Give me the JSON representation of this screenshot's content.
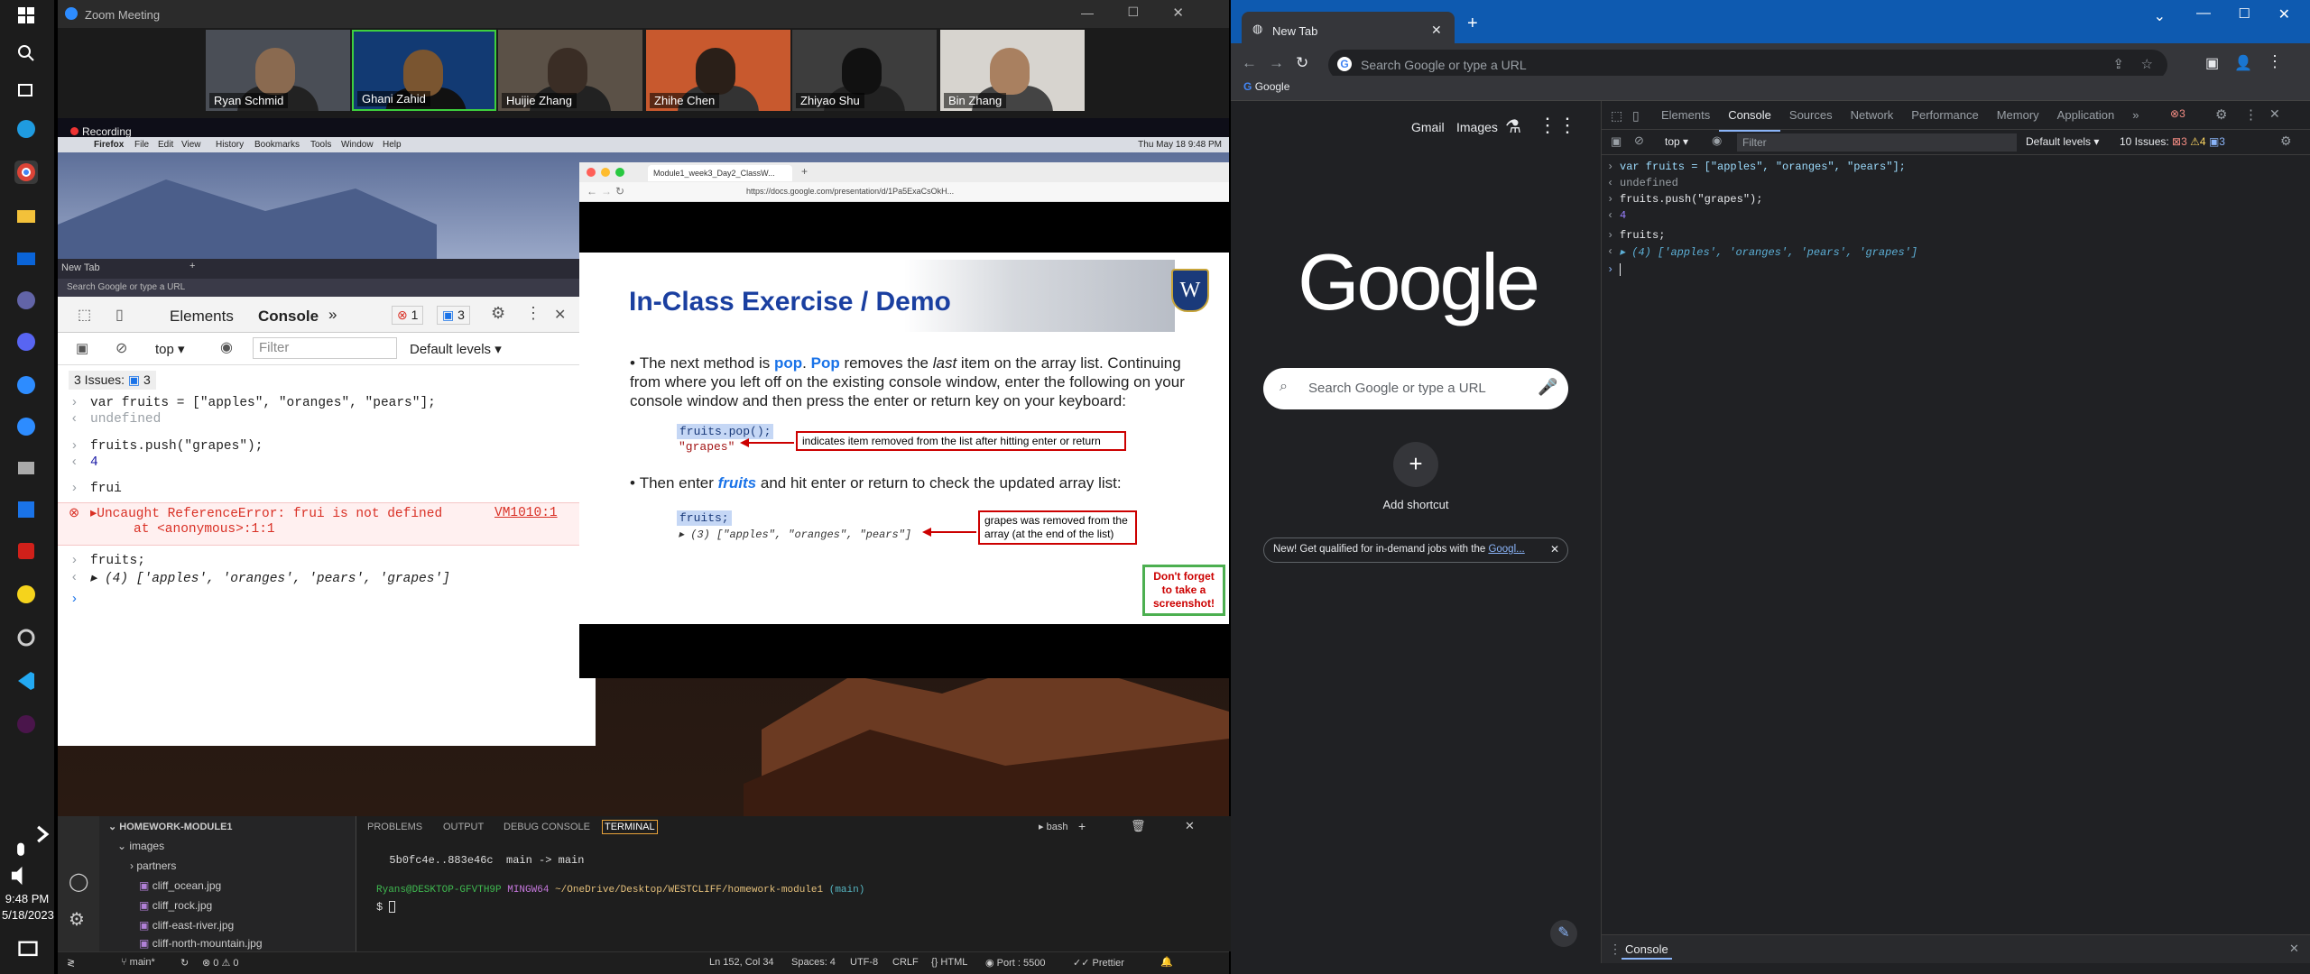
{
  "taskbar": {
    "time": "9:48 PM",
    "date": "5/18/2023",
    "icons": [
      "windows-icon",
      "search-icon",
      "task-view-icon",
      "edge-icon",
      "chrome-icon",
      "file-explorer-icon",
      "mail-icon",
      "teams-icon",
      "discord-icon",
      "zoom-icon",
      "zoom-alt-icon",
      "store-icon",
      "apps-icon",
      "acrobat-icon",
      "norton-icon",
      "settings-icon",
      "vscode-icon",
      "slack-icon"
    ]
  },
  "zoom": {
    "title": "Zoom Meeting",
    "participants": [
      "Ryan Schmid",
      "Ghani Zahid",
      "Huijie Zhang",
      "Zhihe Chen",
      "Zhiyao Shu",
      "Bin Zhang"
    ],
    "recording": "Recording",
    "mac_menu": {
      "apple": "",
      "app": "Firefox",
      "items": [
        "File",
        "Edit",
        "View",
        "History",
        "Bookmarks",
        "Tools",
        "Window",
        "Help"
      ],
      "clock": "Thu May 18  9:48 PM"
    },
    "left_browser": {
      "tab": "New Tab",
      "address": "Search Google or type a URL",
      "devtools_tabs": [
        "Elements",
        "Console"
      ],
      "errors": "1",
      "issues_count": "3",
      "context": "top",
      "filter_placeholder": "Filter",
      "levels": "Default levels",
      "issues_label": "3 Issues:",
      "issues_num": "3",
      "lines": [
        {
          "p": ">",
          "t": "var fruits = [\"apples\", \"oranges\", \"pears\"];"
        },
        {
          "p": "<",
          "t": "undefined"
        },
        {
          "p": ">",
          "t": "fruits.push(\"grapes\");"
        },
        {
          "p": "<",
          "t": "4"
        },
        {
          "p": ">",
          "t": "frui"
        },
        {
          "p": "x",
          "t": "Uncaught ReferenceError: frui is not defined"
        },
        {
          "p": "",
          "t": "at <anonymous>:1:1"
        },
        {
          "p": ">",
          "t": "fruits;"
        },
        {
          "p": "<",
          "t": "(4) ['apples', 'oranges', 'pears', 'grapes']"
        }
      ],
      "error_source": "VM1010:1"
    },
    "slides": {
      "tab": "Module1_week3_Day2_ClassW...",
      "url": "https://docs.google.com/presentation/d/1Pa5ExaCsOkH...",
      "title": "In-Class Exercise / Demo",
      "b1_a": "The next method is ",
      "b1_pop1": "pop",
      "b1_dot": ". ",
      "b1_pop2": "Pop",
      "b1_b": " removes the ",
      "b1_last": "last",
      "b1_c": " item on the array list. Continuing from where you left off on the existing console window, enter the following on your console window and then press the enter or return key on your keyboard:",
      "code1": "fruits.pop();",
      "code1_out": "\"grapes\"",
      "note1": "indicates item removed from the list after hitting enter or return",
      "b2_a": "Then enter ",
      "b2_fruits": "fruits",
      "b2_b": " and hit enter or return to check the updated array list:",
      "code2": "fruits;",
      "code2_out": "(3) [\"apples\", \"oranges\", \"pears\"]",
      "note2": "grapes was removed from the array (at the end of the list)",
      "reminder": "Don't forget to take a screenshot!"
    },
    "vscode": {
      "explorer_title": "HOMEWORK-MODULE1",
      "tree": [
        "images",
        "partners",
        "cliff_ocean.jpg",
        "cliff_rock.jpg",
        "cliff-east-river.jpg",
        "cliff-north-mountain.jpg"
      ],
      "panel_tabs": [
        "PROBLEMS",
        "OUTPUT",
        "DEBUG CONSOLE",
        "TERMINAL"
      ],
      "shell": "bash",
      "term1": "  5b0fc4e..883e46c  main -> main",
      "term_user": "Ryans@DESKTOP-GFVTH9P",
      "term_ming": "MINGW64",
      "term_path": "~/OneDrive/Desktop/WESTCLIFF/homework-module1",
      "term_branch": "(main)",
      "term_prompt": "$ ",
      "status": {
        "branch": "main*",
        "errs": "0",
        "warns": "0",
        "pos": "Ln 152, Col 34",
        "spaces": "Spaces: 4",
        "enc": "UTF-8",
        "eol": "CRLF",
        "lang": "HTML",
        "port": "Port : 5500",
        "prettier": "Prettier"
      }
    }
  },
  "chrome": {
    "tab": "New Tab",
    "address": "Search Google or type a URL",
    "bookmark": "Google",
    "links": [
      "Gmail",
      "Images"
    ],
    "logo": "Google",
    "search_placeholder": "Search Google or type a URL",
    "shortcut": "Add shortcut",
    "promo": "New! Get qualified for in-demand jobs with the ",
    "promo_link": "Googl...",
    "devtools": {
      "tabs": [
        "Elements",
        "Console",
        "Sources",
        "Network",
        "Performance",
        "Memory",
        "Application"
      ],
      "err_count": "3",
      "context": "top",
      "filter_placeholder": "Filter",
      "levels": "Default levels",
      "issues": "10 Issues:",
      "i_err": "3",
      "i_warn": "4",
      "i_info": "3",
      "lines": [
        {
          "p": ">",
          "t": "var fruits = [\"apples\", \"oranges\", \"pears\"];"
        },
        {
          "p": "<",
          "t": "undefined"
        },
        {
          "p": ">",
          "t": "fruits.push(\"grapes\");"
        },
        {
          "p": "<",
          "t": "4"
        },
        {
          "p": ">",
          "t": "fruits;"
        },
        {
          "p": "<",
          "t": "(4) ['apples', 'oranges', 'pears', 'grapes']"
        }
      ],
      "drawer": "Console"
    }
  }
}
